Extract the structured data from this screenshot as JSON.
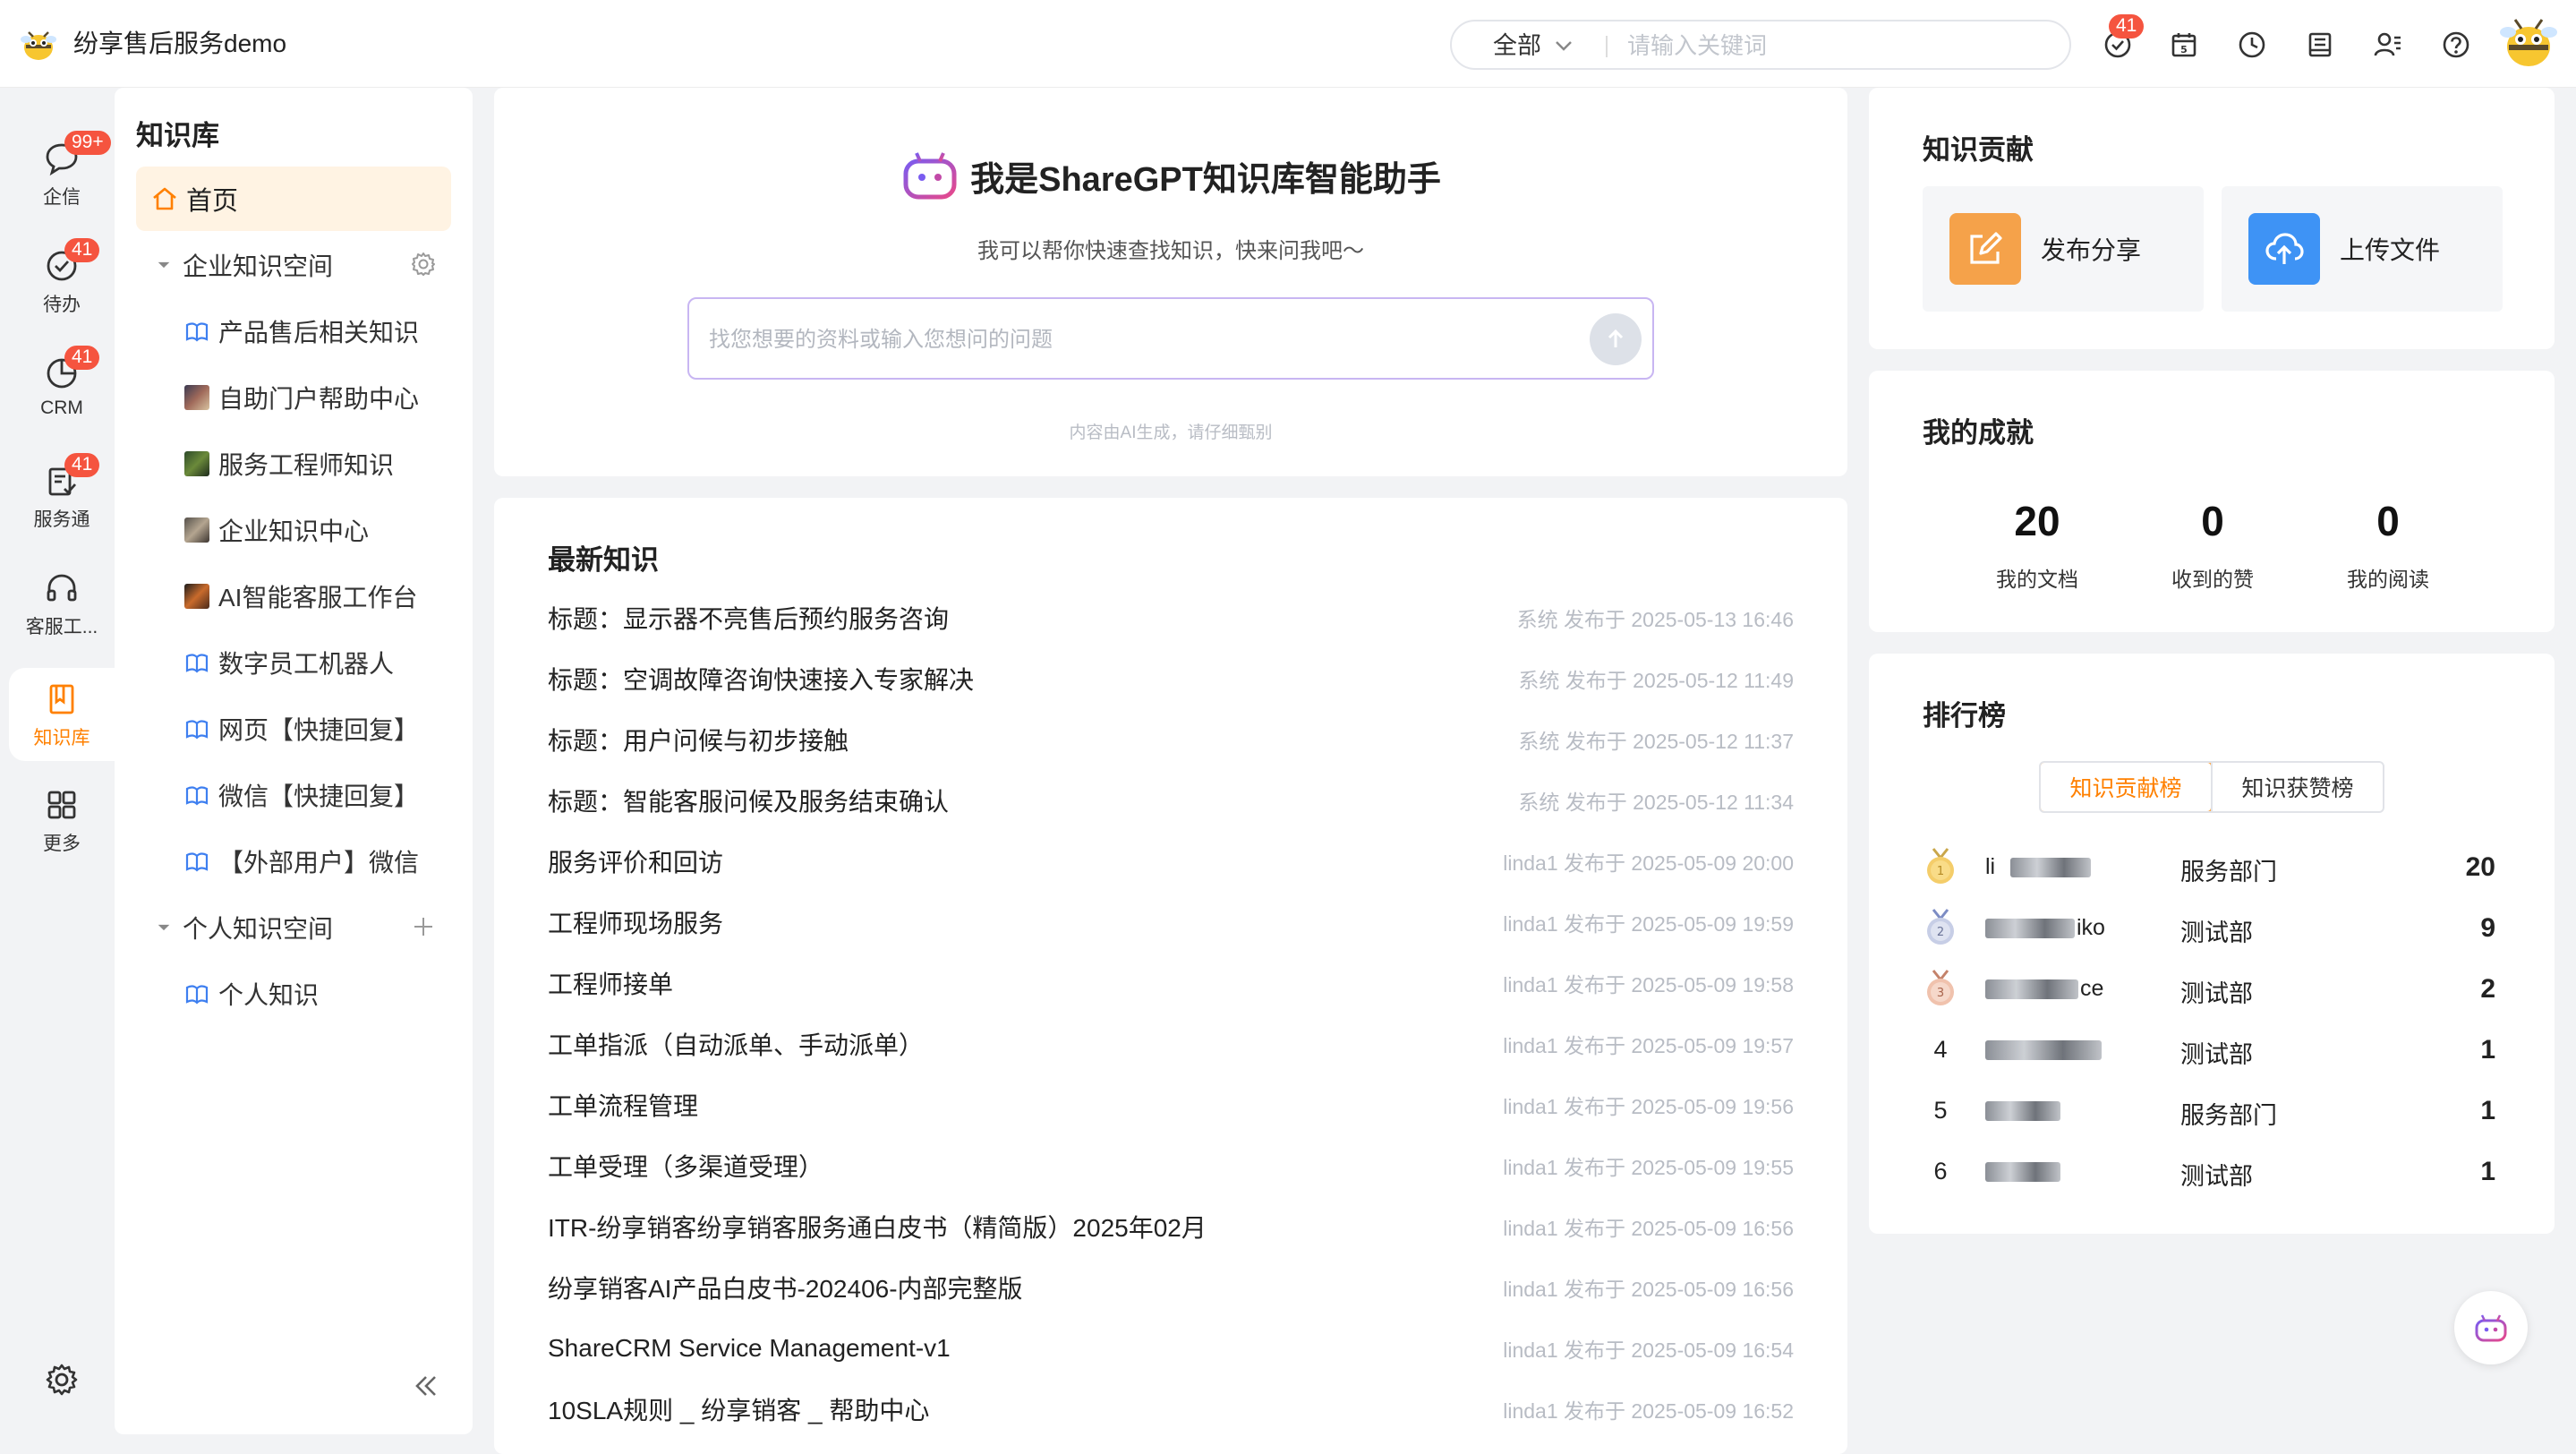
{
  "app": {
    "title": "纷享售后服务demo"
  },
  "search": {
    "scope": "全部",
    "placeholder": "请输入关键词"
  },
  "topbar": {
    "notification_badge": "41"
  },
  "rail": {
    "items": [
      {
        "label": "企信",
        "badge": "99+"
      },
      {
        "label": "待办",
        "badge": "41"
      },
      {
        "label": "CRM",
        "badge": "41"
      },
      {
        "label": "服务通",
        "badge": "41"
      },
      {
        "label": "客服工...",
        "badge": ""
      },
      {
        "label": "知识库",
        "badge": ""
      },
      {
        "label": "更多",
        "badge": ""
      }
    ]
  },
  "tree": {
    "title": "知识库",
    "home": "首页",
    "enterprise_space": "企业知识空间",
    "enterprise_items": [
      "产品售后相关知识",
      "自助门户帮助中心",
      "服务工程师知识",
      "企业知识中心",
      "AI智能客服工作台",
      "数字员工机器人",
      "网页【快捷回复】",
      "微信【快捷回复】",
      "【外部用户】微信"
    ],
    "personal_space": "个人知识空间",
    "personal_items": [
      "个人知识"
    ]
  },
  "assistant": {
    "title": "我是ShareGPT知识库智能助手",
    "subtitle": "我可以帮你快速查找知识，快来问我吧〜",
    "placeholder": "找您想要的资料或输入您想问的问题",
    "note": "内容由AI生成，请仔细甄别"
  },
  "latest": {
    "title": "最新知识",
    "items": [
      {
        "title": "标题：显示器不亮售后预约服务咨询",
        "meta": "系统 发布于 2025-05-13 16:46"
      },
      {
        "title": "标题：空调故障咨询快速接入专家解决",
        "meta": "系统 发布于 2025-05-12 11:49"
      },
      {
        "title": "标题：用户问候与初步接触",
        "meta": "系统 发布于 2025-05-12 11:37"
      },
      {
        "title": "标题：智能客服问候及服务结束确认",
        "meta": "系统 发布于 2025-05-12 11:34"
      },
      {
        "title": "服务评价和回访",
        "meta": "linda1 发布于 2025-05-09 20:00"
      },
      {
        "title": "工程师现场服务",
        "meta": "linda1 发布于 2025-05-09 19:59"
      },
      {
        "title": "工程师接单",
        "meta": "linda1 发布于 2025-05-09 19:58"
      },
      {
        "title": "工单指派（自动派单、手动派单）",
        "meta": "linda1 发布于 2025-05-09 19:57"
      },
      {
        "title": "工单流程管理",
        "meta": "linda1 发布于 2025-05-09 19:56"
      },
      {
        "title": "工单受理（多渠道受理）",
        "meta": "linda1 发布于 2025-05-09 19:55"
      },
      {
        "title": "ITR-纷享销客纷享销客服务通白皮书（精简版）2025年02月",
        "meta": "linda1 发布于 2025-05-09 16:56"
      },
      {
        "title": "纷享销客AI产品白皮书-202406-内部完整版",
        "meta": "linda1 发布于 2025-05-09 16:56"
      },
      {
        "title": "ShareCRM Service Management-v1",
        "meta": "linda1 发布于 2025-05-09 16:54"
      },
      {
        "title": "10SLA规则 _ 纷享销客 _ 帮助中心",
        "meta": "linda1 发布于 2025-05-09 16:52"
      }
    ]
  },
  "contribution": {
    "title": "知识贡献",
    "publish": "发布分享",
    "upload": "上传文件"
  },
  "achievement": {
    "title": "我的成就",
    "stats": [
      {
        "value": "20",
        "label": "我的文档"
      },
      {
        "value": "0",
        "label": "收到的赞"
      },
      {
        "value": "0",
        "label": "我的阅读"
      }
    ]
  },
  "ranking": {
    "title": "排行榜",
    "tabs": [
      "知识贡献榜",
      "知识获赞榜"
    ],
    "rows": [
      {
        "pos": "1",
        "name": "li",
        "dept": "服务部门",
        "score": "20"
      },
      {
        "pos": "2",
        "name": "iko",
        "dept": "测试部",
        "score": "9"
      },
      {
        "pos": "3",
        "name": "ce",
        "dept": "测试部",
        "score": "2"
      },
      {
        "pos": "4",
        "name": "",
        "dept": "测试部",
        "score": "1"
      },
      {
        "pos": "5",
        "name": "",
        "dept": "服务部门",
        "score": "1"
      },
      {
        "pos": "6",
        "name": "",
        "dept": "测试部",
        "score": "1"
      }
    ]
  },
  "colors": {
    "accent": "#ff8000",
    "badge": "#f5543f",
    "publish": "#f5a24a",
    "upload": "#3e93f5"
  }
}
